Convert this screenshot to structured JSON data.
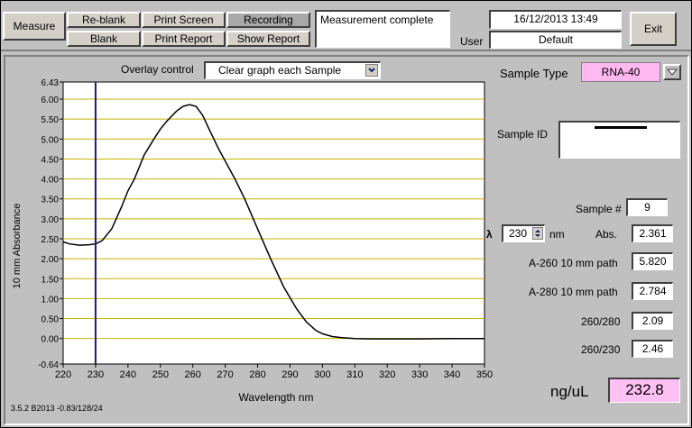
{
  "toolbar": {
    "measure": "Measure",
    "reblank": "Re-blank",
    "blank": "Blank",
    "print_screen": "Print Screen",
    "print_report": "Print Report",
    "recording": "Recording",
    "show_report": "Show Report",
    "status": "Measurement complete",
    "user_label": "User",
    "datetime": "16/12/2013 13:49",
    "user_value": "Default",
    "exit": "Exit"
  },
  "graph": {
    "overlay_label": "Overlay control",
    "overlay_value": "Clear graph each Sample"
  },
  "sample": {
    "type_label": "Sample Type",
    "type_value": "RNA-40",
    "id_label": "Sample ID",
    "number_label": "Sample #",
    "number_value": "9",
    "lambda_symbol": "λ",
    "lambda_value": "230",
    "lambda_unit": "nm",
    "abs_label": "Abs.",
    "abs_value": "2.361",
    "a260_label": "A-260 10 mm path",
    "a260_value": "5.820",
    "a280_label": "A-280 10 mm path",
    "a280_value": "2.784",
    "r260_280_label": "260/280",
    "r260_280_value": "2.09",
    "r260_230_label": "260/230",
    "r260_230_value": "2.46",
    "conc_label": "ng/uL",
    "conc_value": "232.8"
  },
  "footer": {
    "version": "3.5.2 B2013 -0.83/128/24"
  },
  "colors": {
    "background": "#c0c0c0",
    "sample_type_bg": "#ffb8f0",
    "conc_bg": "#ffc0f4",
    "gridline": "#c8b400",
    "cursor": "#1a1a80"
  },
  "chart_data": {
    "type": "line",
    "xlabel": "Wavelength nm",
    "ylabel": "10 mm Absorbance",
    "xlim": [
      220,
      350
    ],
    "ylim": [
      -0.64,
      6.43
    ],
    "xticks": [
      "220",
      "230",
      "240",
      "250",
      "260",
      "270",
      "280",
      "290",
      "300",
      "310",
      "320",
      "330",
      "340",
      "350"
    ],
    "yticks": [
      "6.43",
      "6.00",
      "5.50",
      "5.00",
      "4.50",
      "4.00",
      "3.50",
      "3.00",
      "2.50",
      "2.00",
      "1.50",
      "1.00",
      "0.50",
      "0.00",
      "-0.64"
    ],
    "cursor_x": 230,
    "series": [
      {
        "x": [
          220,
          222,
          225,
          228,
          230,
          232,
          235,
          238,
          240,
          242,
          245,
          248,
          250,
          252,
          255,
          257,
          259,
          261,
          263,
          265,
          268,
          270,
          273,
          276,
          280,
          284,
          288,
          292,
          295,
          298,
          300,
          303,
          306,
          310,
          315,
          320,
          330,
          340,
          350
        ],
        "values": [
          2.42,
          2.37,
          2.34,
          2.35,
          2.37,
          2.45,
          2.75,
          3.3,
          3.7,
          4.0,
          4.6,
          5.0,
          5.25,
          5.45,
          5.7,
          5.82,
          5.86,
          5.82,
          5.6,
          5.25,
          4.75,
          4.45,
          4.0,
          3.5,
          2.75,
          2.0,
          1.3,
          0.75,
          0.42,
          0.2,
          0.12,
          0.05,
          0.02,
          0.0,
          -0.01,
          -0.01,
          -0.01,
          0.0,
          0.0
        ]
      }
    ]
  }
}
